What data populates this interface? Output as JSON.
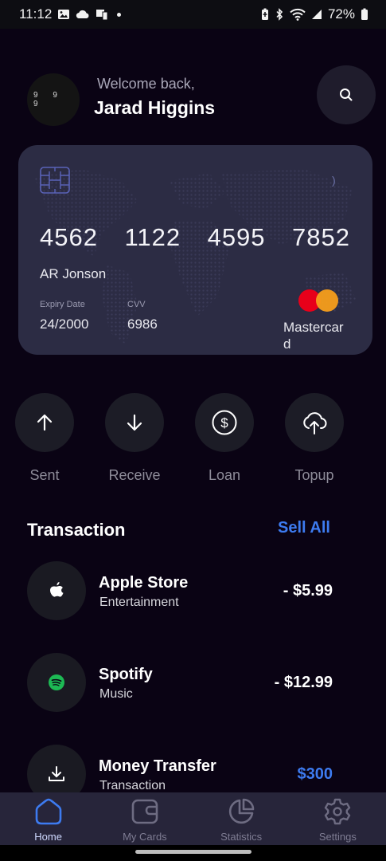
{
  "status_bar": {
    "time": "11:12",
    "battery": "72%",
    "left_icons": [
      "image-icon",
      "cloud-icon",
      "screen-cast-icon",
      "notification-dot-icon"
    ],
    "right_icons": [
      "battery-saver-icon",
      "bluetooth-icon",
      "wifi-icon",
      "signal-icon",
      "battery-icon"
    ]
  },
  "header": {
    "avatar_text": "9 9 9",
    "welcome": "Welcome back,",
    "name": "Jarad Higgins",
    "search_icon": "search-icon"
  },
  "card": {
    "number_groups": [
      "4562",
      "1122",
      "4595",
      "7852"
    ],
    "holder": "AR Jonson",
    "expiry_label": "Expiry Date",
    "expiry_value": "24/2000",
    "cvv_label": "CVV",
    "cvv_value": "6986",
    "brand": "Mastercard",
    "background_color": "#2c2c44"
  },
  "actions": [
    {
      "label": "Sent",
      "icon": "arrow-up-icon"
    },
    {
      "label": "Receive",
      "icon": "arrow-down-icon"
    },
    {
      "label": "Loan",
      "icon": "dollar-circle-icon"
    },
    {
      "label": "Topup",
      "icon": "cloud-upload-icon"
    }
  ],
  "transactions": {
    "title": "Transaction",
    "see_all": "Sell All",
    "items": [
      {
        "name": "Apple Store",
        "category": "Entertainment",
        "amount": "- $5.99",
        "icon": "apple-icon"
      },
      {
        "name": "Spotify",
        "category": "Music",
        "amount": "- $12.99",
        "icon": "spotify-icon"
      },
      {
        "name": "Money Transfer",
        "category": "Transaction",
        "amount": "$300",
        "icon": "download-icon"
      }
    ]
  },
  "nav": [
    {
      "label": "Home",
      "icon": "home-icon",
      "active": true
    },
    {
      "label": "My Cards",
      "icon": "wallet-icon",
      "active": false
    },
    {
      "label": "Statistics",
      "icon": "pie-chart-icon",
      "active": false
    },
    {
      "label": "Settings",
      "icon": "gear-icon",
      "active": false
    }
  ],
  "colors": {
    "background": "#0a0314",
    "accent": "#3d7bf0",
    "nav_background": "#27253a",
    "active_nav": "#3d7bf0"
  }
}
